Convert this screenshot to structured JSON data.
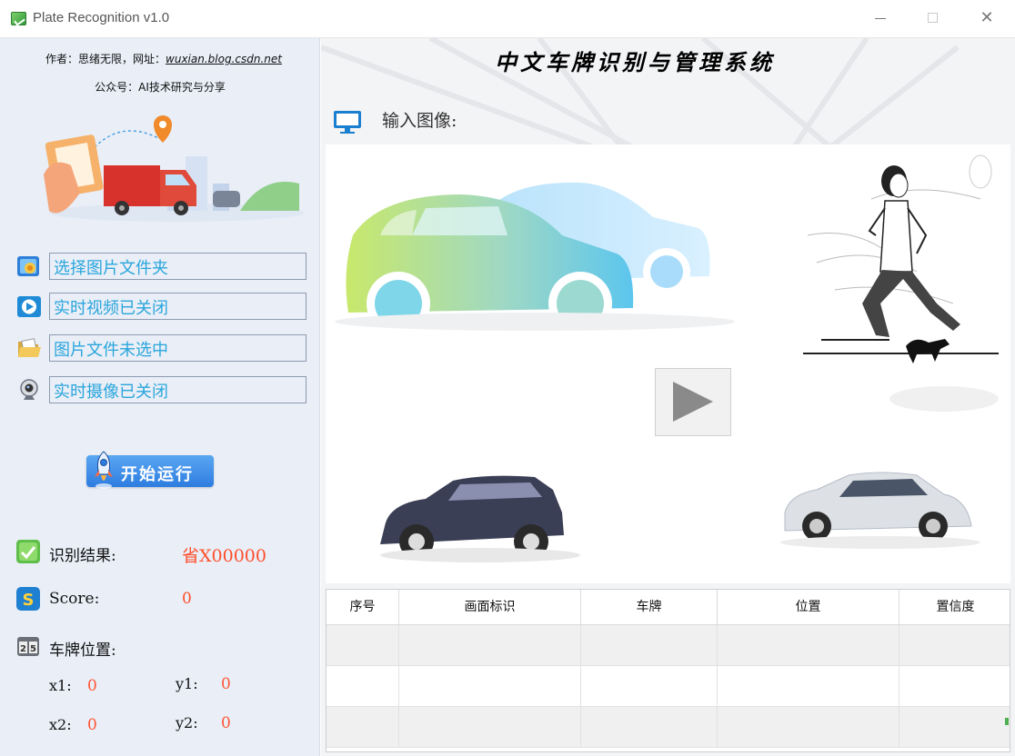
{
  "window": {
    "title": "Plate Recognition v1.0",
    "controls": {
      "minimize": "—",
      "maximize": "□",
      "close": "✕"
    }
  },
  "sidebar": {
    "author_prefix": "作者：思绪无限，网址：",
    "author_url": "wuxian.blog.csdn.net",
    "wechat": "公众号：AI技术研究与分享",
    "menu": [
      {
        "icon": "folder-image-icon",
        "label": "选择图片文件夹"
      },
      {
        "icon": "video-play-icon",
        "label": "实时视频已关闭"
      },
      {
        "icon": "open-folder-icon",
        "label": "图片文件未选中"
      },
      {
        "icon": "webcam-icon",
        "label": "实时摄像已关闭"
      }
    ],
    "run_button": "开始运行",
    "result_label": "识别结果:",
    "result_value": "省X00000",
    "score_label": "Score:",
    "score_value": "0",
    "position_label": "车牌位置:",
    "coords": {
      "x1_label": "x1:",
      "x1": "0",
      "y1_label": "y1:",
      "y1": "0",
      "x2_label": "x2:",
      "x2": "0",
      "y2_label": "y2:",
      "y2": "0"
    }
  },
  "main": {
    "title": "中文车牌识别与管理系统",
    "input_label": "输入图像:"
  },
  "table": {
    "columns": [
      "序号",
      "画面标识",
      "车牌",
      "位置",
      "置信度"
    ],
    "rows": [
      [
        "",
        "",
        "",
        "",
        ""
      ],
      [
        "",
        "",
        "",
        "",
        ""
      ],
      [
        "",
        "",
        "",
        "",
        ""
      ]
    ]
  },
  "colors": {
    "accent_blue": "#2aa6dc",
    "result_orange": "#ff4d2a",
    "sidebar_bg": "#e9eef7",
    "run_button": "#3a8ee6"
  }
}
